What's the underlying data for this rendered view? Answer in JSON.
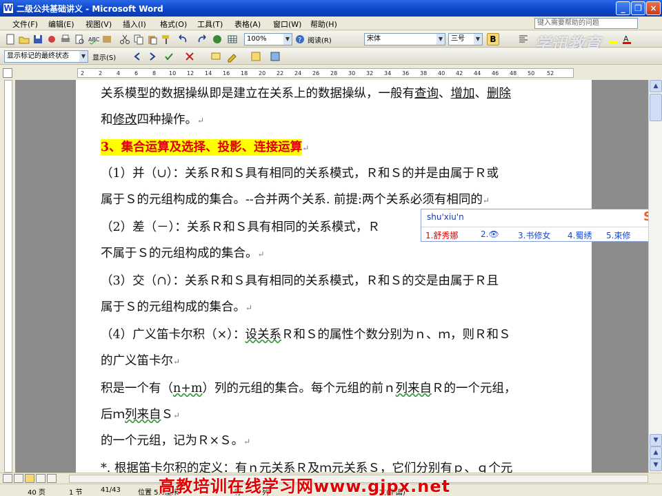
{
  "window": {
    "title": "二级公共基础讲义 - Microsoft Word",
    "app_icon": "W"
  },
  "menu": {
    "items": [
      "文件(F)",
      "编辑(E)",
      "视图(V)",
      "插入(I)",
      "格式(O)",
      "工具(T)",
      "表格(A)",
      "窗口(W)",
      "帮助(H)"
    ],
    "help_placeholder": "键入需要帮助的问题"
  },
  "toolbar": {
    "zoom": "100%",
    "read_label": "阅读(R)",
    "font_name": "宋体",
    "font_size": "三号",
    "bold_label": "B",
    "show_markup": "显示标记的最终状态",
    "show_label": "显示(S)"
  },
  "ruler": {
    "numbers": [
      "2",
      "2",
      "4",
      "6",
      "8",
      "10",
      "12",
      "14",
      "16",
      "18",
      "20",
      "22",
      "24",
      "26",
      "28",
      "30",
      "32",
      "34",
      "36",
      "38",
      "40",
      "42",
      "44",
      "46",
      "48",
      "50",
      "52"
    ]
  },
  "document": {
    "line1_a": "关系模型的数据操纵即是建立在关系上的数据操纵，一般有",
    "line1_q": "查询",
    "line1_sep1": "、",
    "line1_add": "增加",
    "line1_sep2": "、",
    "line1_del": "删除",
    "line2_a": "和",
    "line2_mod": "修改",
    "line2_b": "四种操作。",
    "heading": "3、集合运算及选择、投影、连接运算",
    "p1_l1": "（1）并（∪）：关系Ｒ和Ｓ具有相同的关系模式，Ｒ和Ｓ的并是由属于Ｒ或",
    "p1_l2": "属于Ｓ的元组构成的集合。--合并两个关系. 前提:两个关系必须有相同的",
    "p2_l1": "（2）差（－）：关系Ｒ和Ｓ具有相同的关系模式，Ｒ",
    "p2_l2": "不属于Ｓ的元组构成的集合。",
    "p3_l1": "（3）交（∩）：关系Ｒ和Ｓ具有相同的关系模式，Ｒ和Ｓ的交是由属于Ｒ且",
    "p3_l2": "属于Ｓ的元组构成的集合。",
    "p4_l1_a": "（4）广义笛卡尔积（×）：",
    "p4_l1_u": "设关系",
    "p4_l1_b": "Ｒ和Ｓ的属性个数分别为ｎ、ｍ，则Ｒ和Ｓ",
    "p4_l2": "的广义笛卡尔",
    "p5_l1_a": "积是一个有（",
    "p5_l1_nm": "n+m",
    "p5_l1_b": "）列的元组的集合。每个元组的前ｎ",
    "p5_l1_u": "列来自",
    "p5_l1_c": "Ｒ的一个元组，",
    "p5_l2_a": "后ｍ",
    "p5_l2_u": "列来自",
    "p5_l2_b": "Ｓ",
    "p5_l3": "的一个元组，记为Ｒ×Ｓ。",
    "p6_l1": "*. 根据笛卡尔积的定义：有ｎ元关系Ｒ及ｍ元关系Ｓ，它们分别有ｐ、ｑ个元",
    "para_mark": "↵"
  },
  "ime": {
    "pinyin": "shu'xiu'n",
    "candidates": [
      "1.舒秀娜",
      "2.👁",
      "3.书修女",
      "4.蜀绣",
      "5.束修"
    ],
    "logo": "S"
  },
  "status": {
    "page": "40 页",
    "section": "1 节",
    "page_of": "41/43",
    "position": "位置 5.3厘米",
    "row": "行",
    "col": "列",
    "lang": "中文(中国)"
  },
  "watermark": "高教培训在线学习网www.gjpx.net",
  "logo_watermark": "学迅教育"
}
